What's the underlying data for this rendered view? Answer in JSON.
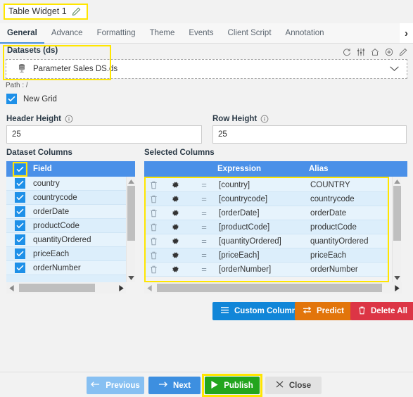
{
  "window": {
    "title": "Table Widget 1",
    "edit_icon": "pencil-icon"
  },
  "tabs": [
    {
      "label": "General",
      "active": true
    },
    {
      "label": "Advance",
      "active": false
    },
    {
      "label": "Formatting",
      "active": false
    },
    {
      "label": "Theme",
      "active": false
    },
    {
      "label": "Events",
      "active": false
    },
    {
      "label": "Client Script",
      "active": false
    },
    {
      "label": "Annotation",
      "active": false
    }
  ],
  "tab_overflow": {
    "icon": "chevron-right-icon",
    "glyph": "›"
  },
  "datasets": {
    "label": "Datasets (ds)",
    "selected_value": "Parameter Sales DS.ds",
    "value_icon": "database-icon",
    "caret_icon": "chevron-down-icon",
    "path_text": "Path : /",
    "toolbar_icons": [
      "refresh-icon",
      "sliders-icon",
      "home-icon",
      "plus-circle-icon",
      "edit-pencil-icon"
    ]
  },
  "new_grid": {
    "label": "New Grid",
    "checked": true
  },
  "header_height": {
    "label": "Header Height",
    "info_icon": "info-icon",
    "value": "25"
  },
  "row_height": {
    "label": "Row Height",
    "info_icon": "info-icon",
    "value": "25"
  },
  "dataset_columns": {
    "section_title": "Dataset Columns",
    "header": {
      "select_all_checked": true,
      "field_label": "Field"
    },
    "rows": [
      {
        "checked": true,
        "field": "country"
      },
      {
        "checked": true,
        "field": "countrycode"
      },
      {
        "checked": true,
        "field": "orderDate"
      },
      {
        "checked": true,
        "field": "productCode"
      },
      {
        "checked": true,
        "field": "quantityOrdered"
      },
      {
        "checked": true,
        "field": "priceEach"
      },
      {
        "checked": true,
        "field": "orderNumber"
      }
    ]
  },
  "selected_columns": {
    "section_title": "Selected Columns",
    "header": {
      "expression": "Expression",
      "alias": "Alias"
    },
    "row_icons": {
      "delete": "trash-icon",
      "settings": "gear-icon",
      "drag": "drag-handle-icon",
      "drag_glyph": "="
    },
    "rows": [
      {
        "expression": "[country]",
        "alias": "COUNTRY"
      },
      {
        "expression": "[countrycode]",
        "alias": "countrycode"
      },
      {
        "expression": "[orderDate]",
        "alias": "orderDate"
      },
      {
        "expression": "[productCode]",
        "alias": "productCode"
      },
      {
        "expression": "[quantityOrdered]",
        "alias": "quantityOrdered"
      },
      {
        "expression": "[priceEach]",
        "alias": "priceEach"
      },
      {
        "expression": "[orderNumber]",
        "alias": "orderNumber"
      }
    ]
  },
  "actions": {
    "custom_columns": {
      "label": "Custom Columns",
      "icon": "hamburger-icon",
      "color": "#1186d8"
    },
    "predict": {
      "label": "Predict",
      "icon": "swap-arrows-icon",
      "color": "#e2750b"
    },
    "delete_all": {
      "label": "Delete All",
      "icon": "trash-icon",
      "color": "#dc3545"
    }
  },
  "footer": {
    "previous": {
      "label": "Previous",
      "icon": "arrow-left-icon",
      "color": "#87c0f2"
    },
    "next": {
      "label": "Next",
      "icon": "arrow-right-icon",
      "color": "#3d8fe0"
    },
    "publish": {
      "label": "Publish",
      "icon": "play-icon",
      "color": "#22a51d"
    },
    "close": {
      "label": "Close",
      "icon": "close-x-icon",
      "color": "#e2e2e2"
    }
  },
  "highlights": {
    "color": "#ffe600",
    "targets": [
      "title",
      "datasets-block",
      "select-all-checkbox",
      "selected-columns-grid",
      "publish-button"
    ]
  }
}
